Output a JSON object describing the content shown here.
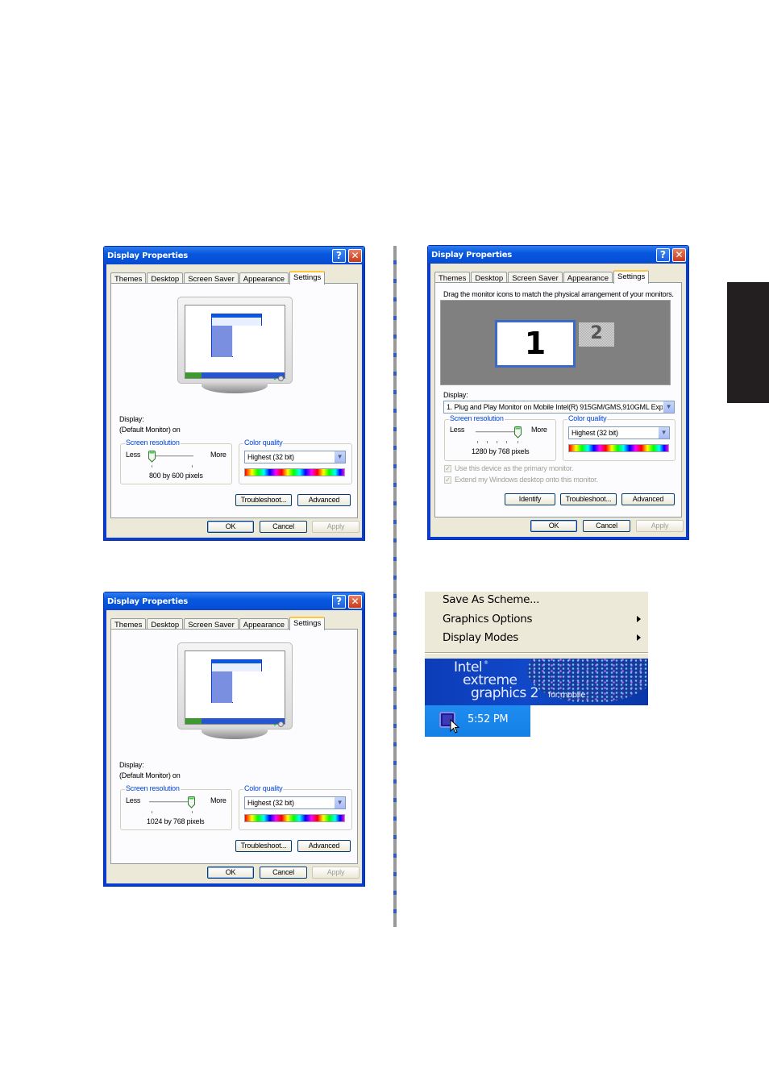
{
  "side_tab": {
    "color": "#231f20"
  },
  "divider": {
    "colors": [
      "#999999",
      "#2e5cb8"
    ]
  },
  "dialogs": [
    {
      "title": "Display Properties",
      "tabs": [
        "Themes",
        "Desktop",
        "Screen Saver",
        "Appearance",
        "Settings"
      ],
      "active_tab": "Settings",
      "display_label": "Display:",
      "display_value": "(Default Monitor) on",
      "resolution_group": "Screen resolution",
      "less": "Less",
      "more": "More",
      "resolution_value": "800 by 600 pixels",
      "resolution_slider_fraction": 0.0,
      "color_group": "Color quality",
      "color_value": "Highest (32 bit)",
      "buttons": {
        "troubleshoot": "Troubleshoot...",
        "advanced": "Advanced",
        "ok": "OK",
        "cancel": "Cancel",
        "apply": "Apply"
      }
    },
    {
      "title": "Display Properties",
      "tabs": [
        "Themes",
        "Desktop",
        "Screen Saver",
        "Appearance",
        "Settings"
      ],
      "active_tab": "Settings",
      "instructions": "Drag the monitor icons to match the physical arrangement of your monitors.",
      "monitors": [
        "1",
        "2"
      ],
      "display_label": "Display:",
      "display_value": "1. Plug and Play Monitor on Mobile Intel(R) 915GM/GMS,910GML Exp",
      "resolution_group": "Screen resolution",
      "less": "Less",
      "more": "More",
      "resolution_value": "1280 by 768 pixels",
      "resolution_slider_fraction": 1.0,
      "color_group": "Color quality",
      "color_value": "Highest (32 bit)",
      "checkbox_primary": "Use this device as the primary monitor.",
      "checkbox_extend": "Extend my Windows desktop onto this monitor.",
      "buttons": {
        "identify": "Identify",
        "troubleshoot": "Troubleshoot...",
        "advanced": "Advanced",
        "ok": "OK",
        "cancel": "Cancel",
        "apply": "Apply"
      }
    },
    {
      "title": "Display Properties",
      "tabs": [
        "Themes",
        "Desktop",
        "Screen Saver",
        "Appearance",
        "Settings"
      ],
      "active_tab": "Settings",
      "display_label": "Display:",
      "display_value": "(Default Monitor) on",
      "resolution_group": "Screen resolution",
      "less": "Less",
      "more": "More",
      "resolution_value": "1024 by 768 pixels",
      "resolution_slider_fraction": 1.0,
      "color_group": "Color quality",
      "color_value": "Highest (32 bit)",
      "buttons": {
        "troubleshoot": "Troubleshoot...",
        "advanced": "Advanced",
        "ok": "OK",
        "cancel": "Cancel",
        "apply": "Apply"
      }
    }
  ],
  "context_menu": {
    "items": [
      {
        "label": "Save As Scheme...",
        "submenu": false
      },
      {
        "label": "Graphics Options",
        "submenu": true
      },
      {
        "label": "Display Modes",
        "submenu": true
      }
    ]
  },
  "banner": {
    "brand": "Intel",
    "trademark": "®",
    "line2": "extreme",
    "line3": "graphics 2",
    "suffix": "for mobile"
  },
  "taskbar": {
    "tray_icon": "intel-graphics-tray-icon",
    "clock": "5:52 PM"
  }
}
